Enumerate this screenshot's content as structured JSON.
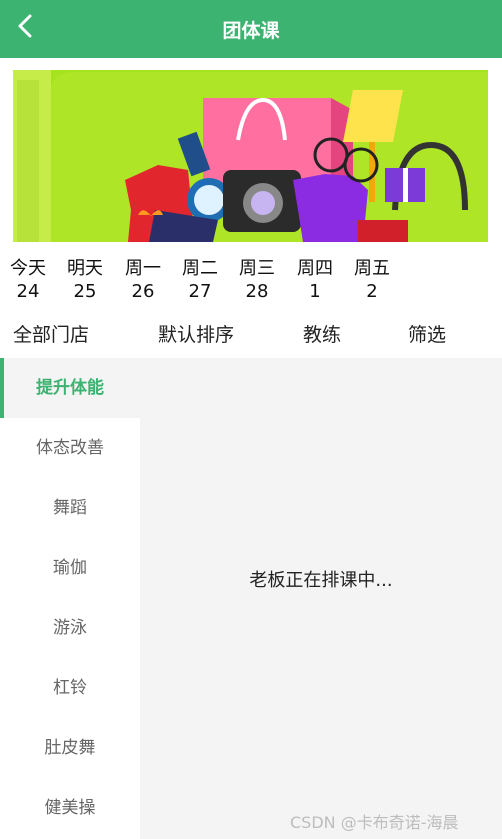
{
  "header": {
    "title": "团体课",
    "back_icon": "chevron-left-icon"
  },
  "banner": {
    "theme_color": "#a6e31f"
  },
  "dates": [
    {
      "weekday": "今天",
      "day": "24"
    },
    {
      "weekday": "明天",
      "day": "25"
    },
    {
      "weekday": "周一",
      "day": "26"
    },
    {
      "weekday": "周二",
      "day": "27"
    },
    {
      "weekday": "周三",
      "day": "28"
    },
    {
      "weekday": "周四",
      "day": "1"
    },
    {
      "weekday": "周五",
      "day": "2"
    }
  ],
  "filters": [
    "全部门店",
    "默认排序",
    "教练",
    "筛选"
  ],
  "categories": [
    "提升体能",
    "体态改善",
    "舞蹈",
    "瑜伽",
    "游泳",
    "杠铃",
    "肚皮舞",
    "健美操"
  ],
  "active_category": "提升体能",
  "empty_message": "老板正在排课中...",
  "watermark": "CSDN @卡布奇诺-海晨",
  "colors": {
    "accent": "#3cb371",
    "panel_bg": "#f4f4f4"
  }
}
